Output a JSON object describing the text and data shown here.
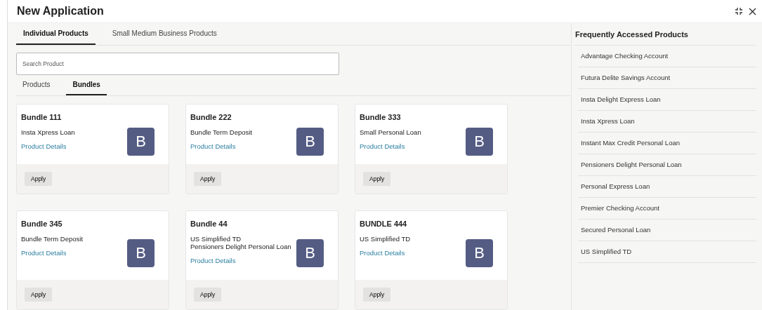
{
  "window": {
    "title": "New Application"
  },
  "tabs": [
    {
      "label": "Individual Products",
      "selected": true
    },
    {
      "label": "Small Medium Business Products",
      "selected": false
    }
  ],
  "search": {
    "placeholder": "Search Product"
  },
  "sub_tabs": [
    {
      "label": "Products",
      "selected": false
    },
    {
      "label": "Bundles",
      "selected": true
    }
  ],
  "bundles": [
    {
      "title": "Bundle 111",
      "products": [
        "Insta Xpress Loan"
      ],
      "link": "Product Details",
      "logo": "B",
      "button": "Apply"
    },
    {
      "title": "Bundle 222",
      "products": [
        "Bundle Term Deposit"
      ],
      "link": "Product Details",
      "logo": "B",
      "button": "Apply"
    },
    {
      "title": "Bundle 333",
      "products": [
        "Small Personal Loan"
      ],
      "link": "Product Details",
      "logo": "B",
      "button": "Apply"
    },
    {
      "title": "Bundle 345",
      "products": [
        "Bundle Term Deposit"
      ],
      "link": "Product Details",
      "logo": "B",
      "button": "Apply"
    },
    {
      "title": "Bundle 44",
      "products": [
        "US Simplified TD",
        "Pensioners Delight Personal Loan"
      ],
      "link": "Product Details",
      "logo": "B",
      "button": "Apply"
    },
    {
      "title": "BUNDLE 444",
      "products": [
        "US Simplified TD"
      ],
      "link": "Product Details",
      "logo": "B",
      "button": "Apply"
    }
  ],
  "frequently_accessed": {
    "title": "Frequently Accessed Products",
    "items": [
      "Advantage Checking Account",
      "Futura Delite Savings Account",
      "Insta Delight Express Loan",
      "Insta Xpress Loan",
      "Instant Max Credit Personal Loan",
      "Pensioners Delight Personal Loan",
      "Personal Express Loan",
      "Premier Checking Account",
      "Secured Personal Loan",
      "US Simplified TD"
    ]
  }
}
